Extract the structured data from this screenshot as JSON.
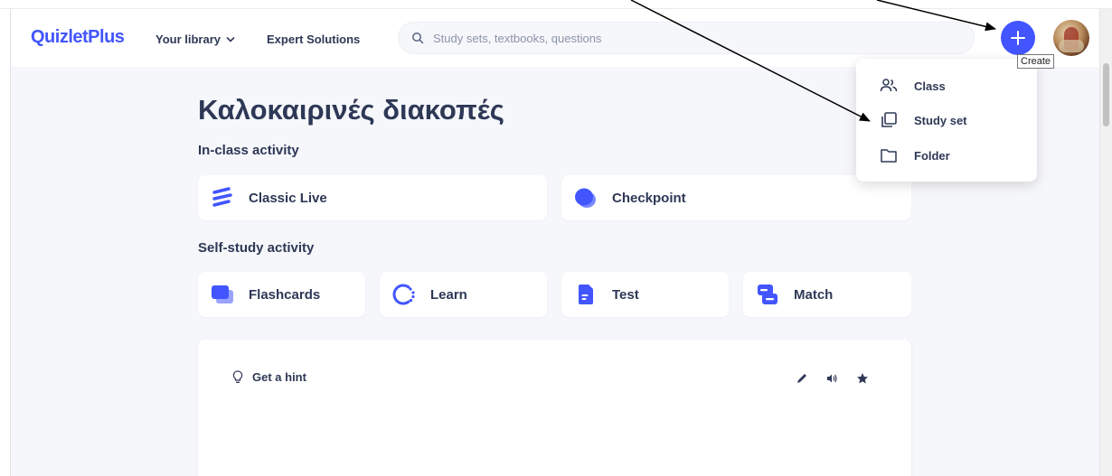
{
  "header": {
    "logo": "QuizletPlus",
    "nav_library": "Your library",
    "nav_expert": "Expert Solutions",
    "search_placeholder": "Study sets, textbooks, questions",
    "create_tooltip": "Create"
  },
  "create_menu": {
    "items": [
      {
        "label": "Class",
        "icon": "people-icon"
      },
      {
        "label": "Study set",
        "icon": "copy-cards-icon"
      },
      {
        "label": "Folder",
        "icon": "folder-icon"
      }
    ]
  },
  "page": {
    "title": "Καλοκαιρινές διακοπές",
    "in_class_label": "In-class activity",
    "in_class": [
      {
        "label": "Classic Live",
        "icon": "classic-live-icon"
      },
      {
        "label": "Checkpoint",
        "icon": "checkpoint-icon"
      }
    ],
    "self_study_label": "Self-study activity",
    "self_study": [
      {
        "label": "Flashcards",
        "icon": "flashcards-icon"
      },
      {
        "label": "Learn",
        "icon": "learn-icon"
      },
      {
        "label": "Test",
        "icon": "test-icon"
      },
      {
        "label": "Match",
        "icon": "match-icon"
      }
    ]
  },
  "flashcard_panel": {
    "hint_label": "Get a hint"
  },
  "colors": {
    "brand": "#4255ff",
    "text": "#2e3856",
    "background": "#f6f7fb"
  }
}
